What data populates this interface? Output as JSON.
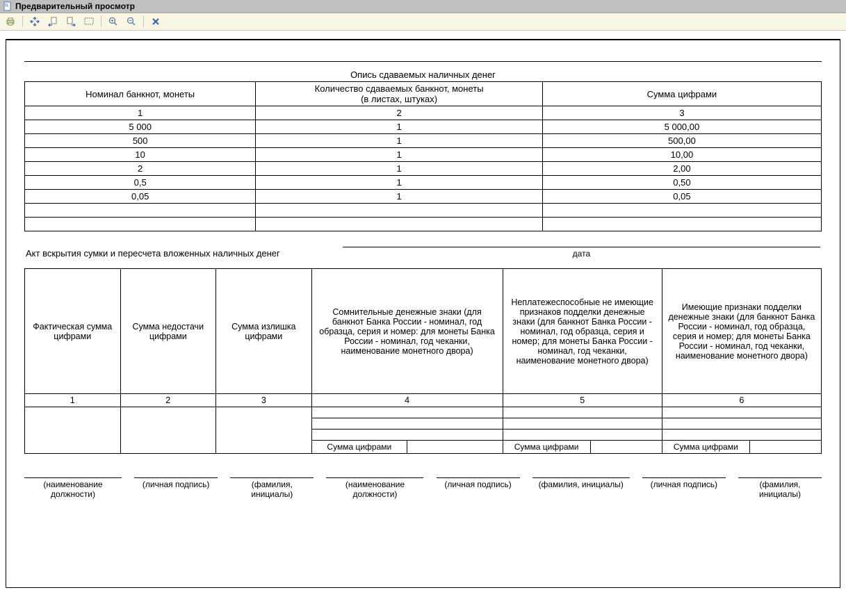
{
  "window": {
    "title": "Предварительный просмотр"
  },
  "icons": {
    "print": "print-icon",
    "fit": "fit-icon",
    "prev": "prev-page-icon",
    "next": "next-page-icon",
    "select": "select-icon",
    "zoom_in": "zoom-in-icon",
    "zoom_out": "zoom-out-icon",
    "close": "close-icon"
  },
  "section1": {
    "title": "Опись сдаваемых наличных денег",
    "headers": {
      "col1": "Номинал банкнот, монеты",
      "col2_line1": "Количество сдаваемых банкнот, монеты",
      "col2_line2": "(в листах, штуках)",
      "col3": "Сумма цифрами"
    },
    "idx": {
      "c1": "1",
      "c2": "2",
      "c3": "3"
    },
    "rows": [
      {
        "nom": "5 000",
        "qty": "1",
        "sum": "5 000,00"
      },
      {
        "nom": "500",
        "qty": "1",
        "sum": "500,00"
      },
      {
        "nom": "10",
        "qty": "1",
        "sum": "10,00"
      },
      {
        "nom": "2",
        "qty": "1",
        "sum": "2,00"
      },
      {
        "nom": "0,5",
        "qty": "1",
        "sum": "0,50"
      },
      {
        "nom": "0,05",
        "qty": "1",
        "sum": "0,05"
      }
    ]
  },
  "act": {
    "text": "Акт вскрытия сумки и пересчета вложенных наличных денег",
    "date_label": "дата"
  },
  "section2": {
    "headers": {
      "c1": "Фактическая сумма цифрами",
      "c2": "Сумма недостачи цифрами",
      "c3": "Сумма излишка цифрами",
      "c4": "Сомнительные денежные знаки (для банкнот Банка России - номинал, год образца, серия и номер: для монеты Банка России - номинал, год чеканки, наименование монетного двора)",
      "c5": "Неплатежеспособные не имеющие признаков подделки денежные знаки (для банкнот Банка России - номинал, год образца, серия и номер; для монеты Банка России - номинал, год чеканки, наименование монетного двора)",
      "c6": "Имеющие признаки подделки денежные знаки (для банкнот Банка России - номинал, год образца, серия и номер; для монеты Банка России - номинал, год чеканки, наименование монетного двора)"
    },
    "idx": {
      "c1": "1",
      "c2": "2",
      "c3": "3",
      "c4": "4",
      "c5": "5",
      "c6": "6"
    },
    "sum_label": "Сумма цифрами"
  },
  "signatures": {
    "s1": "(наименование должности)",
    "s2": "(личная подпись)",
    "s3": "(фамилия, инициалы)",
    "s4": "(наименование должности)",
    "s5": "(личная подпись)",
    "s6": "(фамилия, инициалы)",
    "s7": "(личная подпись)",
    "s8": "(фамилия, инициалы)"
  }
}
